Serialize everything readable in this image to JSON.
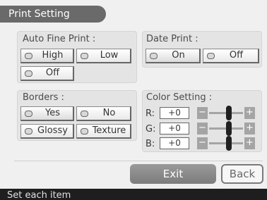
{
  "header": {
    "title": "Print Setting"
  },
  "auto_fine_print": {
    "label": "Auto Fine Print :",
    "options": [
      "High",
      "Low",
      "Off"
    ]
  },
  "date_print": {
    "label": "Date Print :",
    "options": [
      "On",
      "Off"
    ]
  },
  "borders": {
    "label": "Borders :",
    "options": [
      "Yes",
      "No",
      "Glossy",
      "Texture"
    ]
  },
  "color_setting": {
    "label": "Color Setting :",
    "rows": [
      {
        "channel": "R:",
        "value": "+0"
      },
      {
        "channel": "G:",
        "value": "+0"
      },
      {
        "channel": "B:",
        "value": "+0"
      }
    ],
    "minus": "−",
    "plus": "+"
  },
  "footer": {
    "exit_label": "Exit",
    "back_label": "Back"
  },
  "status": {
    "text": "Set each item"
  }
}
